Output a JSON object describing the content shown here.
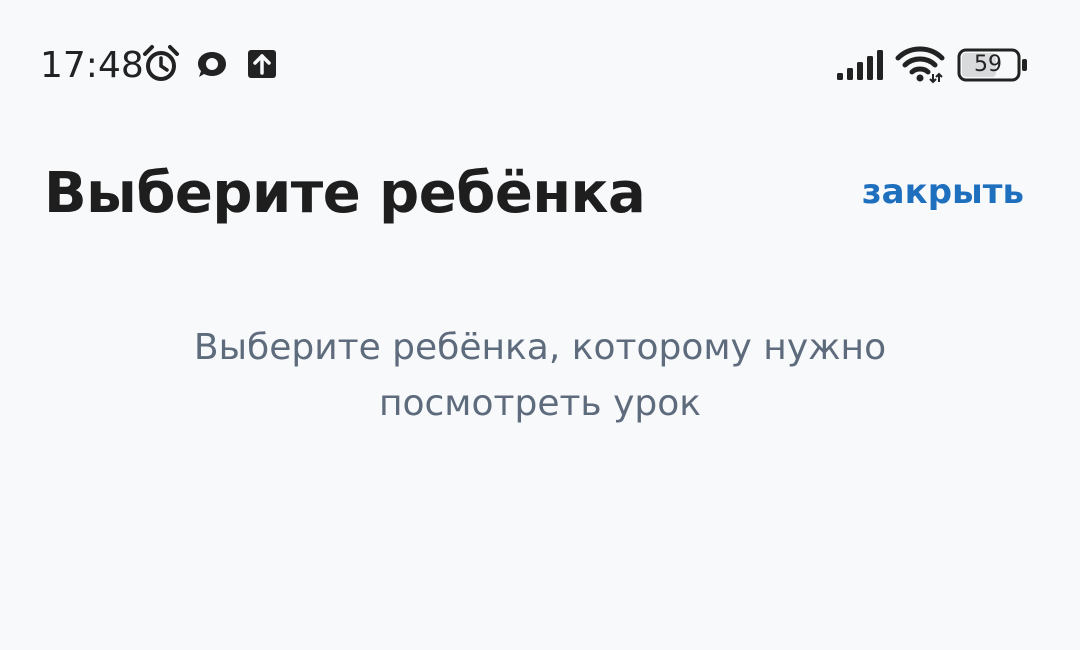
{
  "status_bar": {
    "time": "17:48",
    "icons": [
      "alarm-icon",
      "chat-icon",
      "upload-icon",
      "signal-icon",
      "wifi-icon",
      "battery-icon"
    ],
    "battery_level": "59"
  },
  "header": {
    "title": "Выберите ребёнка",
    "close_label": "закрыть"
  },
  "main": {
    "description": "Выберите ребёнка, которому нужно посмотреть урок"
  },
  "colors": {
    "background": "#F8F9FB",
    "title": "#1E1E1E",
    "accent_link": "#1F6FBF",
    "description_text": "#5E6B7D"
  }
}
